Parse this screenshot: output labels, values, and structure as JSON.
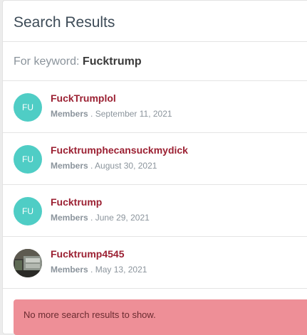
{
  "header": {
    "title": "Search Results"
  },
  "keyword": {
    "prefix": "For keyword:",
    "value": "Fucktrump"
  },
  "results": [
    {
      "avatar_initials": "FU",
      "name": "FuckTrumplol",
      "category": "Members",
      "separator": ".",
      "date": "September 11, 2021"
    },
    {
      "avatar_initials": "FU",
      "name": "Fucktrumphecansuckmydick",
      "category": "Members",
      "separator": ".",
      "date": "August 30, 2021"
    },
    {
      "avatar_initials": "FU",
      "name": "Fucktrump",
      "category": "Members",
      "separator": ".",
      "date": "June 29, 2021"
    },
    {
      "avatar_initials": "",
      "name": "Fucktrump4545",
      "category": "Members",
      "separator": ".",
      "date": "May 13, 2021"
    }
  ],
  "notice": {
    "text": "No more search results to show."
  },
  "colors": {
    "avatar_teal": "#4fcdc5",
    "link_red": "#9b2032",
    "notice_pink": "#ee8f97"
  }
}
